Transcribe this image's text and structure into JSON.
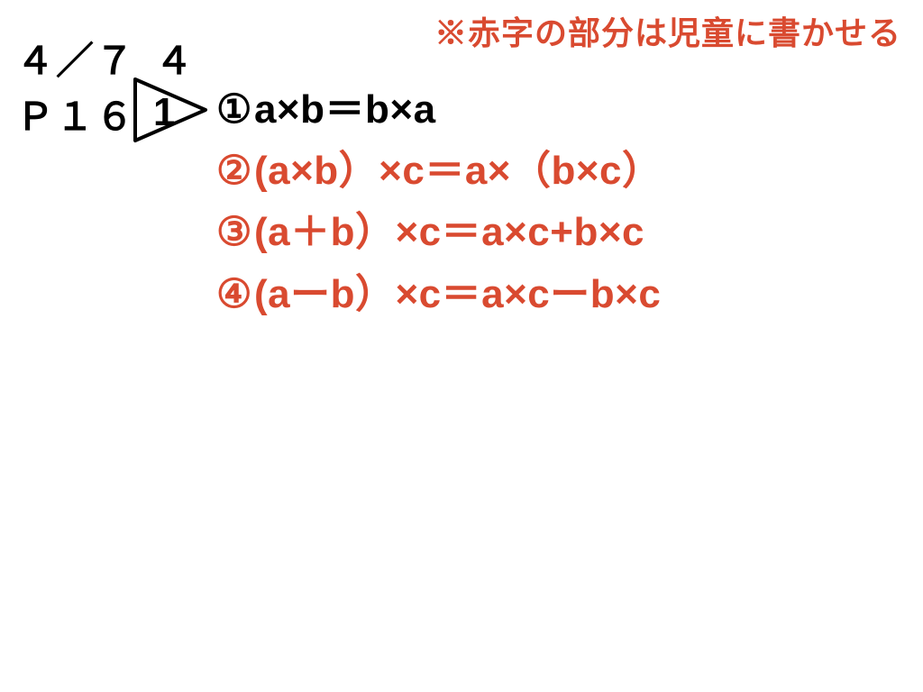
{
  "note": "※赤字の部分は児童に書かせる",
  "meta": {
    "date": "４／７",
    "page": "Ｐ１６",
    "section_no": "４",
    "triangle_label": "1"
  },
  "formulas": [
    {
      "marker": "①",
      "pre": "",
      "body": "a×b＝b×a"
    },
    {
      "marker": "②",
      "pre": "(a×b）×c＝a×（b×c）",
      "body": ""
    },
    {
      "marker": "③",
      "pre": "(a＋b）×c＝a×c+b×c",
      "body": ""
    },
    {
      "marker": "④",
      "pre": "(aーb）×c＝a×cーb×c",
      "body": ""
    }
  ],
  "colors": {
    "red": "#d94a30",
    "black": "#000000"
  }
}
